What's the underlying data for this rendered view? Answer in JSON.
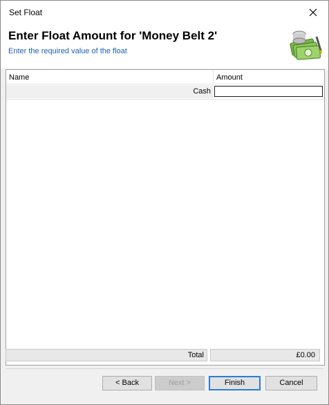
{
  "window": {
    "title": "Set Float"
  },
  "header": {
    "title": "Enter Float Amount for 'Money Belt 2'",
    "subtitle": "Enter the required value of the float",
    "graphic": "money-stack-icon"
  },
  "grid": {
    "columns": [
      "Name",
      "Amount"
    ],
    "rows": [
      {
        "name": "Cash",
        "amount": ""
      }
    ]
  },
  "totals": {
    "label": "Total",
    "value": "£0.00"
  },
  "buttons": {
    "back": "< Back",
    "next": "Next >",
    "finish": "Finish",
    "cancel": "Cancel"
  },
  "icons": {
    "close": "close-icon"
  },
  "colors": {
    "subtitle": "#1a5fb4",
    "focus": "#2b7bd6"
  }
}
